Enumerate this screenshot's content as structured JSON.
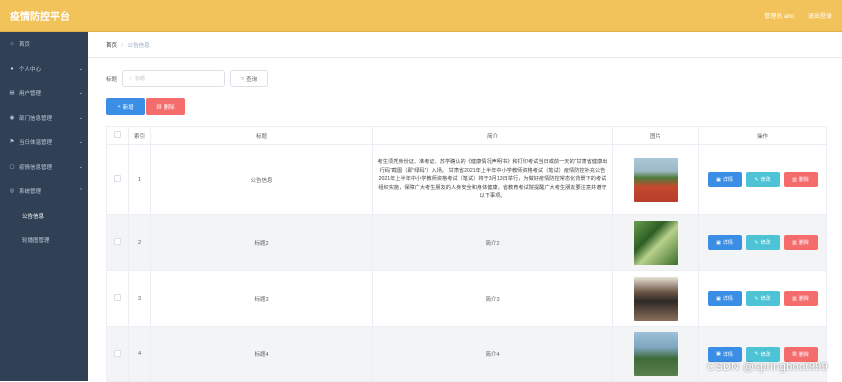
{
  "app": {
    "title": "疫情防控平台"
  },
  "topbar": {
    "user_label": "管理员 abo",
    "logout": "退出登录"
  },
  "sidebar": {
    "items": [
      {
        "label": "首页",
        "icon": "home-icon",
        "has_children": false
      },
      {
        "label": "个人中心",
        "icon": "user-icon",
        "has_children": true
      },
      {
        "label": "用户管理",
        "icon": "list-icon",
        "has_children": true
      },
      {
        "label": "部门信息管理",
        "icon": "location-icon",
        "has_children": true
      },
      {
        "label": "当日体温管理",
        "icon": "flag-icon",
        "has_children": true
      },
      {
        "label": "疫情信息管理",
        "icon": "document-icon",
        "has_children": true
      },
      {
        "label": "系统管理",
        "icon": "settings-icon",
        "has_children": true
      }
    ],
    "sub_items": [
      {
        "label": "公告信息"
      },
      {
        "label": "轮播图管理"
      }
    ]
  },
  "breadcrumb": {
    "home": "首页",
    "sep": "/",
    "current": "公告信息"
  },
  "search": {
    "label": "标题",
    "placeholder": "标题",
    "button": "查询"
  },
  "toolbar": {
    "add": "新增",
    "delete": "删除"
  },
  "table": {
    "headers": [
      "索引",
      "标题",
      "简介",
      "图片",
      "操作"
    ],
    "rows": [
      {
        "index": "1",
        "title": "公告信息",
        "intro": "考生须凭身份证、准考证、苏学确认的《健康情况声明书》和打印考试当日或前一天的“甘肃省健康出行码”截图（即“绿码”）入场。 甘肃省2021年上半年中小学教师资格考试（笔试）疫情防控补充公告 2021年上半年中小学教师资格考试（笔试）将于3月13日举行，为做好疫情防控常态化背景下的考试组织实施，保障广大考生朋友的人身安全和身体健康，省教育考试院提醒广大考生朋友要注意并遵守以下事项。",
        "image": "running-track-photo"
      },
      {
        "index": "2",
        "title": "标题2",
        "intro": "简介2",
        "image": "campus-path-photo"
      },
      {
        "index": "3",
        "title": "标题3",
        "intro": "简介3",
        "image": "classroom-photo"
      },
      {
        "index": "4",
        "title": "标题4",
        "intro": "简介4",
        "image": "campus-aerial-photo"
      }
    ],
    "row_actions": {
      "detail": "详情",
      "edit": "修改",
      "delete": "删除"
    }
  },
  "watermark": "CSDN @springboot999",
  "colors": {
    "topbar": "#f2c35a",
    "sidebar": "#304156",
    "primary": "#3a8ee6",
    "danger": "#f56c6c",
    "info": "#4ec3d6"
  }
}
